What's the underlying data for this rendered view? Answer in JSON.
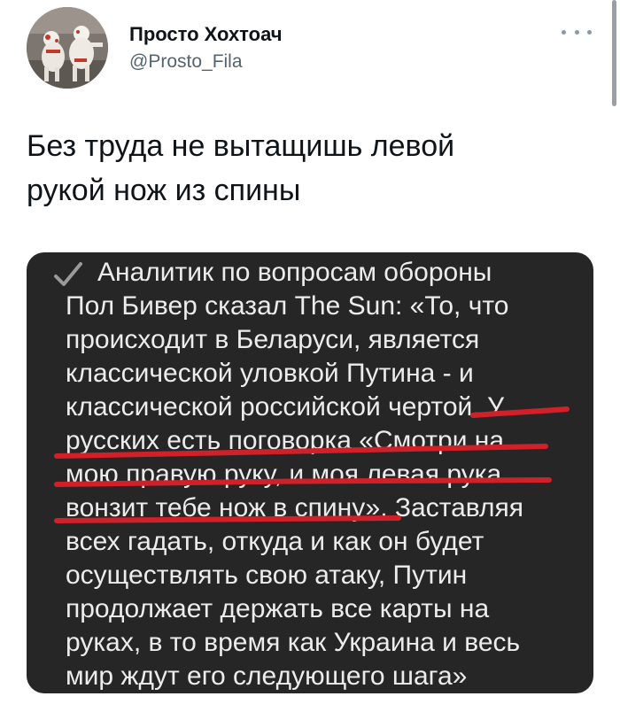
{
  "author": {
    "display_name": "Просто Хохтоач",
    "username": "@Prosto_Fila",
    "avatar_icon": "avatar-figures-image",
    "more_icon": "more-dots-icon"
  },
  "tweet": {
    "text": "Без труда не вытащишь левой\nрукой нож из спины"
  },
  "media": {
    "check_icon": "checkmark-icon",
    "lines": [
      "Аналитик по вопросам обороны",
      "Пол Бивер сказал The Sun: «То, что",
      "происходит в Беларуси, является",
      "классической уловкой Путина - и",
      "классической российской чертой. У",
      "русских есть поговорка «Смотри на",
      "мою правую руку, и моя левая рука",
      "вонзит тебе нож в спину». Заставляя",
      "всех гадать, откуда и как он будет",
      "осуществлять свою атаку, Путин",
      "продолжает держать все карты на",
      "руках, в то время как Украина и весь",
      "мир ждут его следующего шага»"
    ],
    "underline_color": "#d0202a",
    "text_color": "#ececec",
    "background_color": "#262626"
  },
  "colors": {
    "name": "#0f1419",
    "handle": "#536471",
    "accent_underline": "#d0202a"
  }
}
